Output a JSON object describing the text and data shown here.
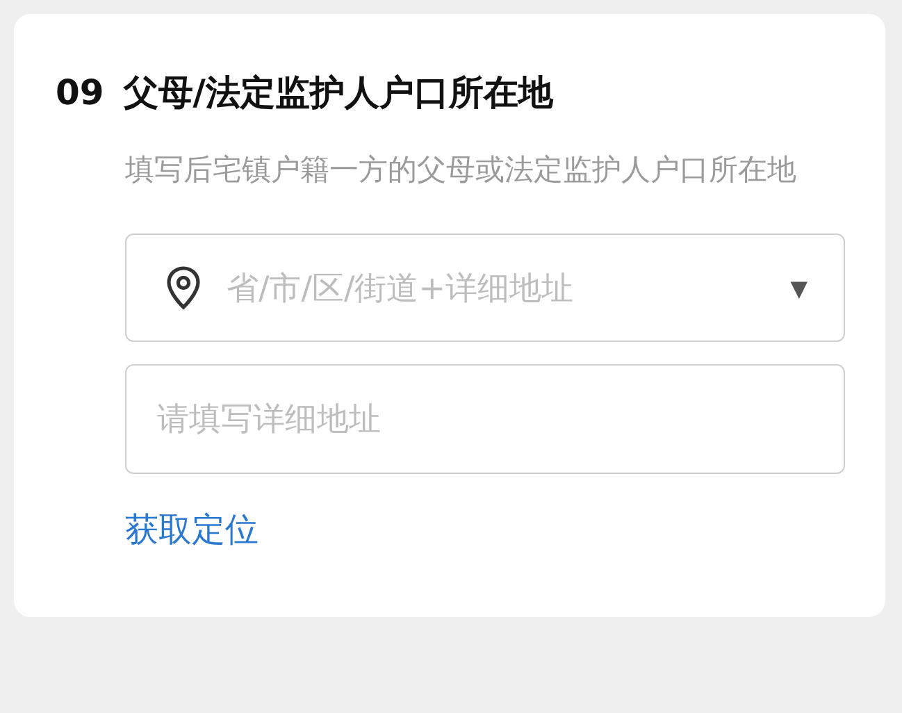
{
  "question": {
    "number": "09",
    "title": "父母/法定监护人户口所在地",
    "description": "填写后宅镇户籍一方的父母或法定监护人户口所在地"
  },
  "region_select": {
    "placeholder": "省/市/区/街道+详细地址",
    "caret": "▼"
  },
  "address_input": {
    "placeholder": "请填写详细地址"
  },
  "locate_link": "获取定位"
}
